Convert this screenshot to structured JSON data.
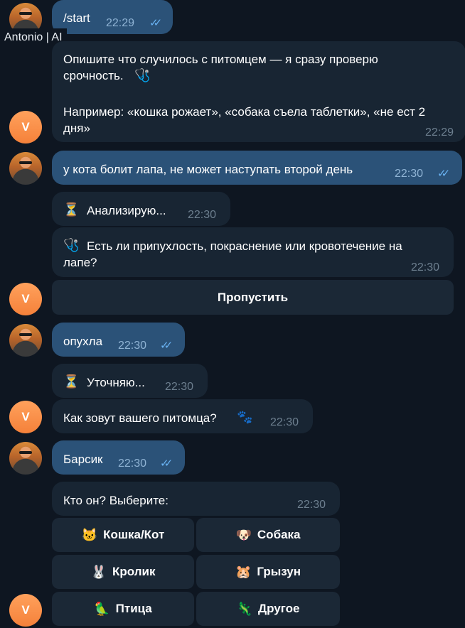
{
  "tooltip": "Antonio | AI",
  "messages": {
    "start": {
      "text": "/start",
      "time": "22:29",
      "ticks": "✓✓"
    },
    "intro": {
      "line1": "Опишите что случилось с питомцем — я сразу проверю",
      "line2": "срочность.",
      "line3": "Например: «кошка рожает», «собака съела таблетки», «не ест 2",
      "line4": "дня»",
      "time": "22:29"
    },
    "paw_msg": {
      "text": "у кота болит лапа, не может наступать второй день",
      "time": "22:30",
      "ticks": "✓✓"
    },
    "analyzing": {
      "icon": "⏳",
      "text": "Анализирую...",
      "time": "22:30"
    },
    "question": {
      "line1": "Есть ли припухлость, покраснение или кровотечение на",
      "line2": "лапе?",
      "time": "22:30"
    },
    "skip_button": "Пропустить",
    "swollen": {
      "text": "опухла",
      "time": "22:30",
      "ticks": "✓✓"
    },
    "clarifying": {
      "icon": "⏳",
      "text": "Уточняю...",
      "time": "22:30"
    },
    "pet_name_q": {
      "text": "Как зовут вашего питомца?",
      "icon": "🐾",
      "time": "22:30"
    },
    "barsik": {
      "text": "Барсик",
      "time": "22:30",
      "ticks": "✓✓"
    },
    "who_q": {
      "text": "Кто он? Выберите:",
      "time": "22:30"
    },
    "choices": [
      {
        "icon": "🐱",
        "label": "Кошка/Кот"
      },
      {
        "icon": "🐶",
        "label": "Собака"
      },
      {
        "icon": "🐰",
        "label": "Кролик"
      },
      {
        "icon": "🐹",
        "label": "Грызун"
      },
      {
        "icon": "🦜",
        "label": "Птица"
      },
      {
        "icon": "🦎",
        "label": "Другое"
      }
    ],
    "bot_avatar_letter": "V"
  },
  "colors": {
    "background": "#0e1621",
    "outgoing_bubble": "#2b5278",
    "incoming_bubble": "#182533",
    "inline_button": "#1b2836",
    "bot_avatar": "#f5813a",
    "read_ticks": "#6ab3f3"
  }
}
